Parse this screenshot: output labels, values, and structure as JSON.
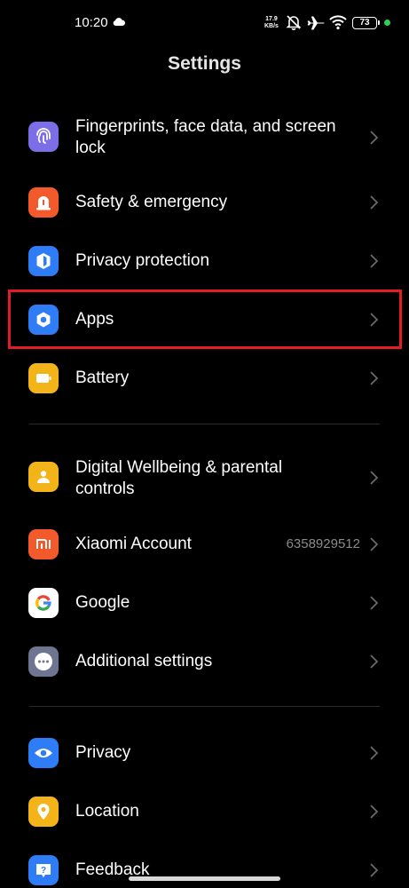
{
  "status_bar": {
    "time": "10:20",
    "net_speed_value": "17.9",
    "net_speed_unit": "KB/s",
    "battery": "73",
    "icons": [
      "cloud-icon",
      "mute-icon",
      "airplane-icon",
      "wifi-icon",
      "battery-icon"
    ]
  },
  "header": {
    "title": "Settings"
  },
  "sections": {
    "row_fingerprints": {
      "label": "Fingerprints, face data, and screen lock",
      "icon": "fingerprint-icon",
      "color": "#7b6ee6"
    },
    "row_safety": {
      "label": "Safety & emergency",
      "icon": "emergency-icon",
      "color": "#f25a2c"
    },
    "row_privacy_protection": {
      "label": "Privacy protection",
      "icon": "shield-icon",
      "color": "#2f7df6"
    },
    "row_apps": {
      "label": "Apps",
      "icon": "apps-gear-icon",
      "color": "#2f7df6"
    },
    "row_battery": {
      "label": "Battery",
      "icon": "battery-icon",
      "color": "#f3b41a"
    },
    "row_wellbeing": {
      "label": "Digital Wellbeing & parental controls",
      "icon": "wellbeing-icon",
      "color": "#f3b41a"
    },
    "row_xiaomi": {
      "label": "Xiaomi Account",
      "value": "6358929512",
      "icon": "mi-logo-icon",
      "color": "#f25a2c"
    },
    "row_google": {
      "label": "Google",
      "icon": "google-g-icon",
      "color": "#ffffff"
    },
    "row_additional": {
      "label": "Additional settings",
      "icon": "more-dots-icon",
      "color": "#6e7590"
    },
    "row_privacy": {
      "label": "Privacy",
      "icon": "eye-icon",
      "color": "#2f7df6"
    },
    "row_location": {
      "label": "Location",
      "icon": "location-pin-icon",
      "color": "#f3b41a"
    },
    "row_feedback": {
      "label": "Feedback",
      "icon": "feedback-icon",
      "color": "#2f7df6"
    }
  },
  "highlight_color": "#e31b23"
}
